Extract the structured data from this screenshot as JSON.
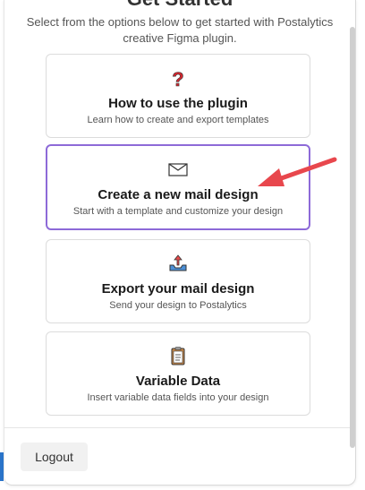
{
  "header": {
    "title": "Get Started",
    "subtitle": "Select from the options below to get started with Postalytics creative Figma plugin."
  },
  "cards": [
    {
      "icon": "question-icon",
      "title": "How to use the plugin",
      "description": "Learn how to create and export templates",
      "selected": false
    },
    {
      "icon": "envelope-icon",
      "title": "Create a new mail design",
      "description": "Start with a template and customize your design",
      "selected": true
    },
    {
      "icon": "export-icon",
      "title": "Export your mail design",
      "description": "Send your design to Postalytics",
      "selected": false
    },
    {
      "icon": "clipboard-icon",
      "title": "Variable Data",
      "description": "Insert variable data fields into your design",
      "selected": false
    }
  ],
  "footer": {
    "logout_label": "Logout"
  },
  "colors": {
    "accent": "#8d6ad8",
    "arrow": "#e8474d"
  }
}
